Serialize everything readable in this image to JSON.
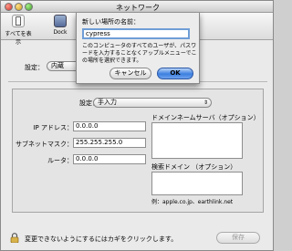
{
  "window": {
    "title": "ネットワーク"
  },
  "toolbar": {
    "show_all_label": "すべてを表示",
    "dock_label": "Dock"
  },
  "location": {
    "label": "設定：",
    "value": "内蔵"
  },
  "panel": {
    "config_label": "設定：",
    "config_value": "手入力",
    "ip_label": "IP アドレス：",
    "ip_value": "0.0.0.0",
    "subnet_label": "サブネットマスク：",
    "subnet_value": "255.255.255.0",
    "router_label": "ルータ：",
    "router_value": "0.0.0.0",
    "dns_label": "ドメインネームサーバ（オプション）",
    "search_label": "検索ドメイン （オプション）",
    "example_text": "例：apple.co.jp、earthlink.net"
  },
  "footer": {
    "lock_text": "変更できないようにするにはカギをクリックします。",
    "save_label": "保存"
  },
  "sheet": {
    "name_label": "新しい場所の名前：",
    "name_value": "cypress",
    "description": "このコンピュータのすべてのユーザが、パスワードを入力することなくアップルメニューでこの場所を選択できます。",
    "cancel_label": "キャンセル",
    "ok_label": "OK"
  },
  "colors": {
    "ok_button": "#3c7fe0",
    "focus_ring": "#6f9ed6"
  }
}
